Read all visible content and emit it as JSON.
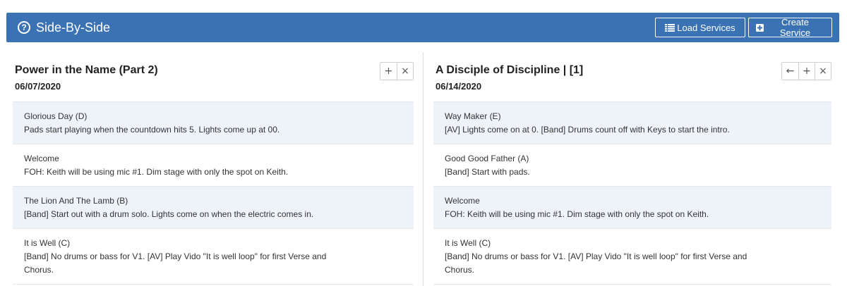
{
  "app": {
    "title": "Side-By-Side",
    "help_icon_glyph": "?",
    "accent_color": "#3a72b4"
  },
  "header": {
    "load_label": "Load Services",
    "create_label": "Create Service"
  },
  "left": {
    "title": "Power in the Name (Part 2)",
    "date": "06/07/2020",
    "items": [
      {
        "title": "Glorious Day (D)",
        "note": "Pads start playing when the countdown hits 5. Lights come up at 00."
      },
      {
        "title": "Welcome",
        "note": "FOH: Keith will be using mic #1. Dim stage with only the spot on Keith."
      },
      {
        "title": "The Lion And The Lamb (B)",
        "note": "[Band] Start out with a drum solo. Lights come on when the electric comes in."
      },
      {
        "title": "It is Well (C)",
        "note": "[Band] No drums or bass for V1. [AV] Play Vido \"It is well loop\" for first Verse and Chorus."
      }
    ]
  },
  "right": {
    "title": "A Disciple of Discipline | [1]",
    "date": "06/14/2020",
    "items": [
      {
        "title": "Way Maker (E)",
        "note": "[AV] Lights come on at 0. [Band] Drums count off with Keys to start the intro."
      },
      {
        "title": "Good Good Father (A)",
        "note": "[Band] Start with pads."
      },
      {
        "title": "Welcome",
        "note": "FOH: Keith will be using mic #1. Dim stage with only the spot on Keith."
      },
      {
        "title": "It is Well (C)",
        "note": "[Band] No drums or bass for V1. [AV] Play Vido \"It is well loop\" for first Verse and Chorus."
      }
    ]
  },
  "icons": {
    "add": "+",
    "close": "×",
    "back": "←"
  }
}
